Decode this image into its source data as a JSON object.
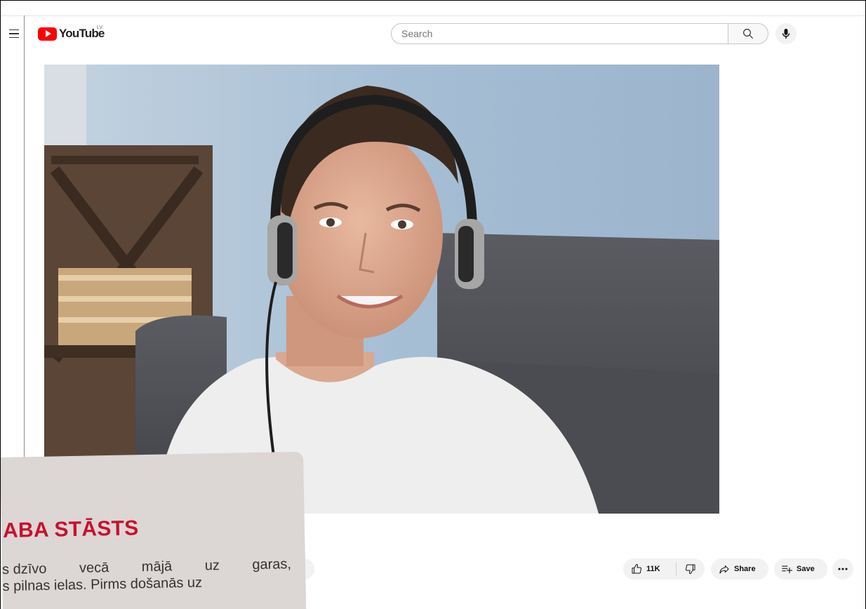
{
  "masthead": {
    "logo_text": "YouTube",
    "country_code": "LV",
    "search_placeholder": "Search",
    "icons": {
      "menu": "hamburger-icon",
      "search": "search-icon",
      "mic": "microphone-icon"
    }
  },
  "actions": {
    "like_count": "11K",
    "share_label": "Share",
    "save_label": "Save",
    "icons": {
      "like": "thumbs-up-icon",
      "dislike": "thumbs-down-icon",
      "share": "share-arrow-icon",
      "save": "playlist-add-icon",
      "more": "more-horizontal-icon"
    }
  },
  "overlay_card": {
    "title": "ABA STĀSTS",
    "line1_left": "s dzīvo",
    "line1_mid": "vecā",
    "line1_mid2": "mājā",
    "line1_mid3": "uz",
    "line1_right": "garas,",
    "line2": "s pilnas ielas. Pirms došanās uz"
  },
  "colors": {
    "brand_red": "#ff0000",
    "card_title_red": "#c8102e",
    "card_bg": "#dcd6d5",
    "pill_bg": "#f2f2f2"
  }
}
